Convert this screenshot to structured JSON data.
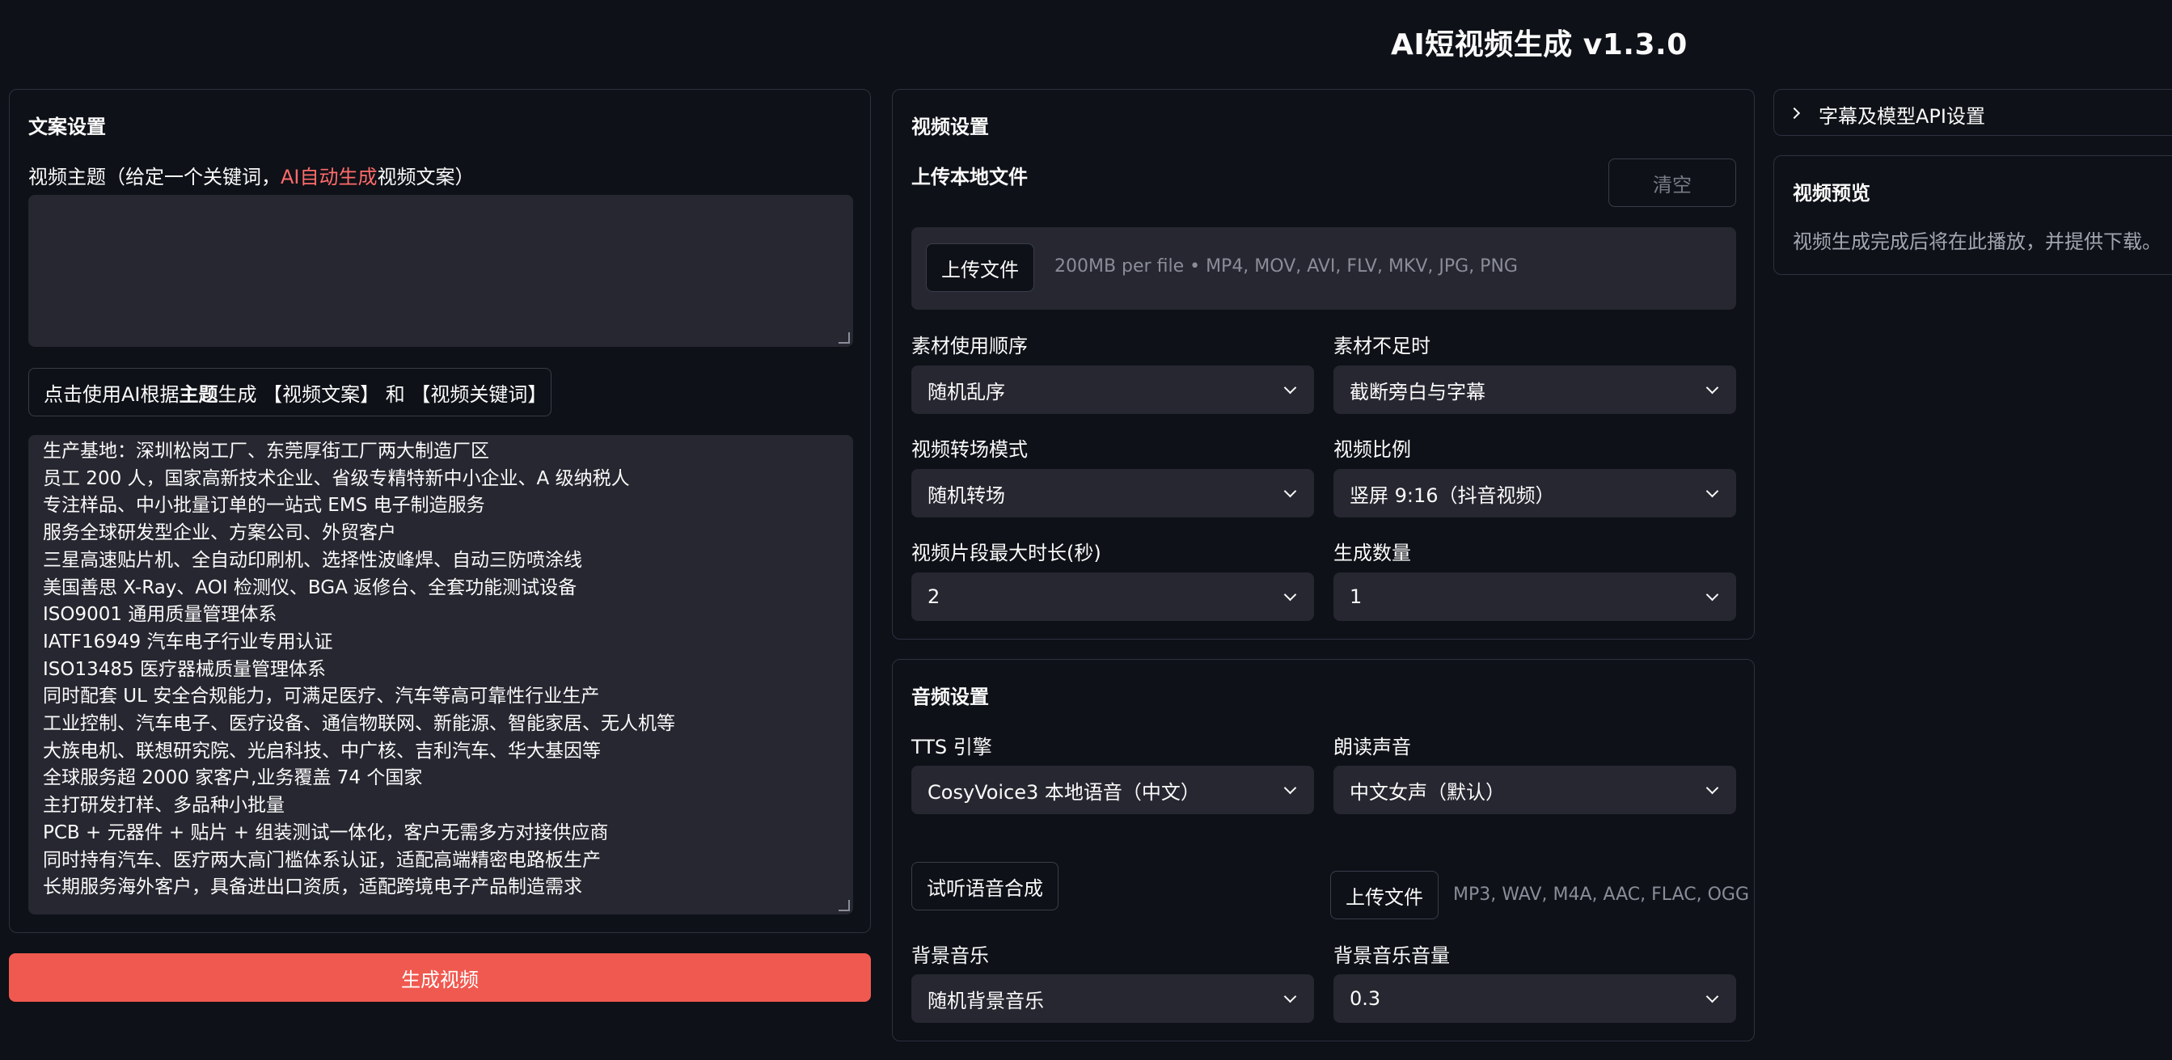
{
  "header": {
    "title": "AI短视频生成 v1.3.0"
  },
  "script_settings": {
    "title": "文案设置",
    "subject_label_prefix": "视频主题（给定一个关键词，",
    "subject_label_accent": "AI自动生成",
    "subject_label_suffix": "视频文案）",
    "subject_value": "",
    "ai_button": {
      "prefix": "点击使用AI根据",
      "bold": "主题",
      "suffix": "生成 【视频文案】 和 【视频关键词】"
    },
    "script_lines": [
      "生产基地：深圳松岗工厂、东莞厚街工厂两大制造厂区",
      "员工 200 人，国家高新技术企业、省级专精特新中小企业、A 级纳税人",
      "专注样品、中小批量订单的一站式 EMS 电子制造服务",
      "服务全球研发型企业、方案公司、外贸客户",
      "三星高速贴片机、全自动印刷机、选择性波峰焊、自动三防喷涂线",
      "美国善思 X-Ray、AOI 检测仪、BGA 返修台、全套功能测试设备",
      "ISO9001 通用质量管理体系",
      "IATF16949 汽车电子行业专用认证",
      "ISO13485 医疗器械质量管理体系",
      "同时配套 UL 安全合规能力，可满足医疗、汽车等高可靠性行业生产",
      "工业控制、汽车电子、医疗设备、通信物联网、新能源、智能家居、无人机等",
      "大族电机、联想研究院、光启科技、中广核、吉利汽车、华大基因等",
      "全球服务超 2000 家客户,业务覆盖 74 个国家",
      "主打研发打样、多品种小批量",
      "PCB + 元器件 + 贴片 + 组装测试一体化，客户无需多方对接供应商",
      "同时持有汽车、医疗两大高门槛体系认证，适配高端精密电路板生产",
      "长期服务海外客户，具备进出口资质，适配跨境电子产品制造需求"
    ],
    "generate_button": "生成视频"
  },
  "video_settings": {
    "title": "视频设置",
    "upload_label": "上传本地文件",
    "clear_button": "清空",
    "upload_button": "上传文件",
    "upload_hint": "200MB per file • MP4, MOV, AVI, FLV, MKV, JPG, PNG",
    "order_label": "素材使用顺序",
    "order_value": "随机乱序",
    "shortage_label": "素材不足时",
    "shortage_value": "截断旁白与字幕",
    "transition_label": "视频转场模式",
    "transition_value": "随机转场",
    "ratio_label": "视频比例",
    "ratio_value": "竖屏 9:16（抖音视频）",
    "clip_duration_label": "视频片段最大时长(秒)",
    "clip_duration_value": "2",
    "count_label": "生成数量",
    "count_value": "1"
  },
  "audio_settings": {
    "title": "音频设置",
    "tts_label": "TTS 引擎",
    "tts_value": "CosyVoice3 本地语音（中文）",
    "voice_label": "朗读声音",
    "voice_value": "中文女声（默认）",
    "preview_button": "试听语音合成",
    "upload_button": "上传文件",
    "upload_hint": "MP3, WAV, M4A, AAC, FLAC, OGG",
    "bgm_label": "背景音乐",
    "bgm_value": "随机背景音乐",
    "bgm_volume_label": "背景音乐音量",
    "bgm_volume_value": "0.3"
  },
  "right_panel": {
    "expander_label": "字幕及模型API设置",
    "preview_title": "视频预览",
    "preview_text": "视频生成完成后将在此播放，并提供下载。"
  }
}
